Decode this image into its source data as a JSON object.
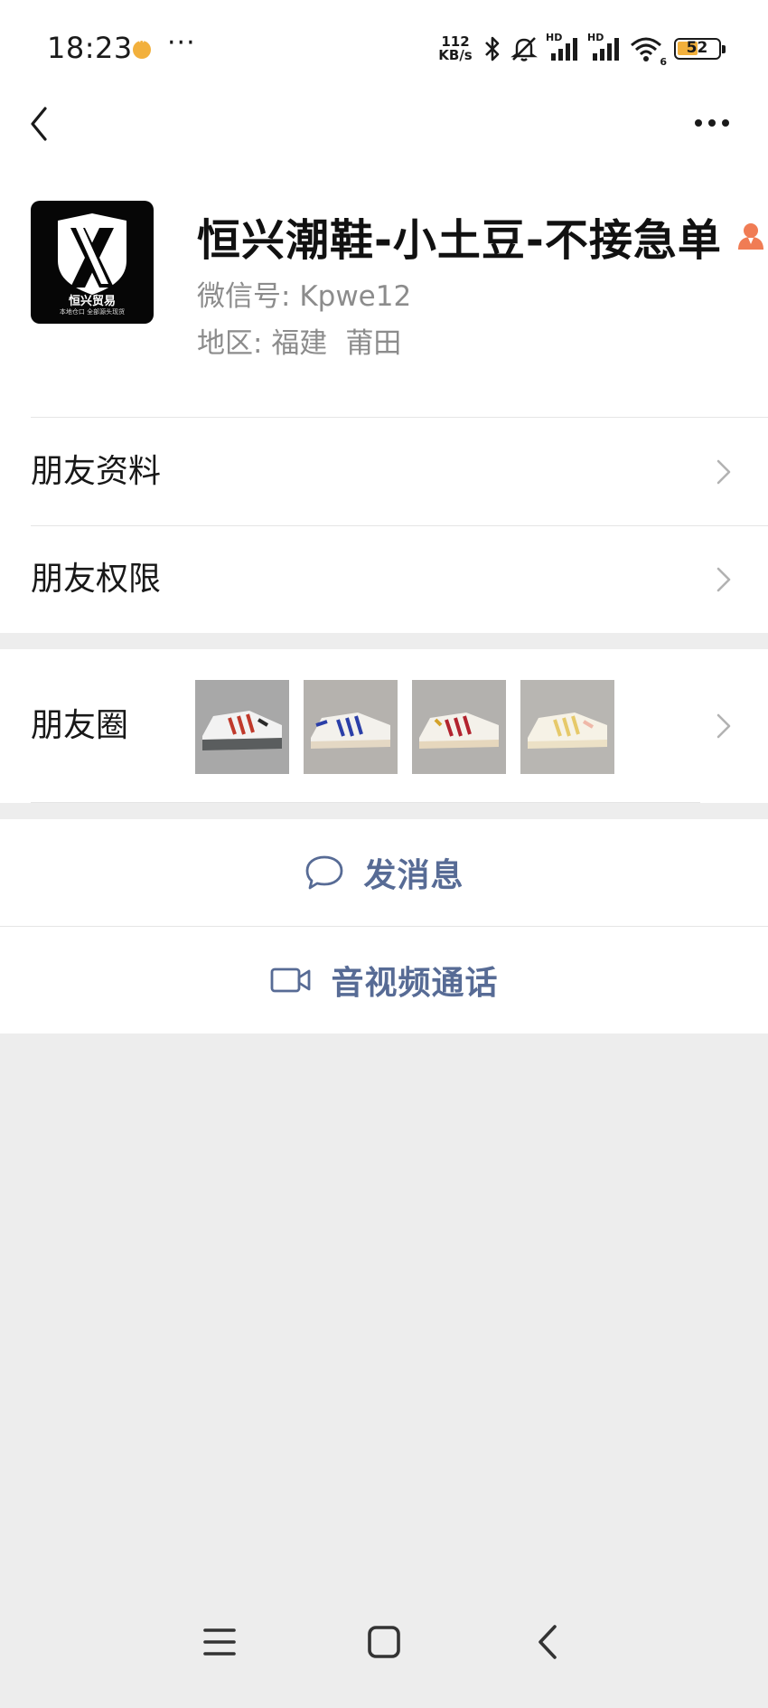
{
  "status_bar": {
    "time": "18:23",
    "more": "···",
    "net_speed_value": "112",
    "net_speed_unit": "KB/s",
    "hd1": "HD",
    "hd2": "HD",
    "wifi_sub": "6",
    "battery": "52",
    "battery_level_percent": 52
  },
  "nav": {
    "back_icon": "back-chevron-icon",
    "menu_icon": "more-dots-icon"
  },
  "profile": {
    "name": "恒兴潮鞋-小土豆-不接急单",
    "tag_icon": "person-tag-icon",
    "wechat_id_label": "微信号:",
    "wechat_id_value": "Kpwe12",
    "region_label": "地区:",
    "region_province": "福建",
    "region_city": "莆田",
    "avatar": {
      "logo_title": "恒兴贸易",
      "logo_subtitle": "本地仓口 全部源头现货"
    }
  },
  "rows": {
    "friend_info": "朋友资料",
    "friend_permissions": "朋友权限",
    "moments": "朋友圈"
  },
  "moments_thumbs": [
    {
      "name": "sneaker-white-grey-red",
      "accent": "#c0392b"
    },
    {
      "name": "sneaker-white-blue",
      "accent": "#2b3fa8"
    },
    {
      "name": "sneaker-white-red",
      "accent": "#b2232e"
    },
    {
      "name": "sneaker-cream-yellow",
      "accent": "#e6c96a"
    }
  ],
  "actions": {
    "message": "发消息",
    "call": "音视频通话"
  },
  "colors": {
    "link_blue": "#576b95",
    "accent_orange": "#f07c54",
    "background": "#ededed"
  }
}
